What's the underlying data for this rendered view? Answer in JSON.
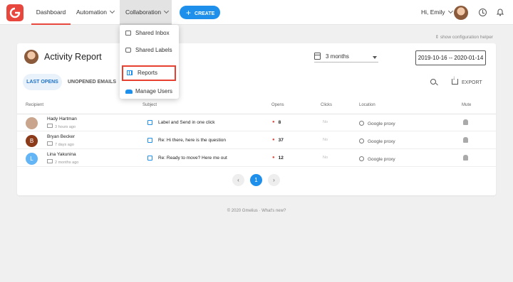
{
  "nav": {
    "dashboard": "Dashboard",
    "automation": "Automation",
    "collaboration": "Collaboration",
    "create": "CREATE",
    "greeting": "Hi, Emily"
  },
  "collab_menu": {
    "items": [
      {
        "label": "Shared Inbox",
        "icon": "inbox-icon"
      },
      {
        "label": "Shared Labels",
        "icon": "label-icon"
      },
      {
        "label": "Reports",
        "icon": "bar-chart-icon"
      },
      {
        "label": "Manage Users",
        "icon": "users-icon"
      }
    ]
  },
  "config_helper": "show configuration helper",
  "report": {
    "title": "Activity Report",
    "range_select": "3 months",
    "date_range": "2019-10-16 -- 2020-01-14",
    "tabs": {
      "opens": "LAST OPENS",
      "unopened": "UNOPENED EMAILS"
    },
    "export": "EXPORT",
    "columns": {
      "recipient": "Recipient",
      "subject": "Subject",
      "opens": "Opens",
      "clicks": "Clicks",
      "location": "Location",
      "mute": "Mute"
    },
    "rows": [
      {
        "initial": "",
        "name": "Hady Hartman",
        "time": "3 hours ago",
        "subject": "Label and Send in one click",
        "opens": "8",
        "clicks": "No",
        "location": "Google proxy",
        "color": "#c8a58c"
      },
      {
        "initial": "B",
        "name": "Bryan Becker",
        "time": "7 days ago",
        "subject": "Re: Hi there, here is the question",
        "opens": "37",
        "clicks": "No",
        "location": "Google proxy",
        "color": "#8b3a1a"
      },
      {
        "initial": "L",
        "name": "Lina Yakunina",
        "time": "2 months ago",
        "subject": "Re: Ready to move? Here me out",
        "opens": "12",
        "clicks": "No",
        "location": "Google proxy",
        "color": "#64b5f6"
      }
    ],
    "pager": {
      "prev": "‹",
      "current": "1",
      "next": "›"
    }
  },
  "footer": "© 2020 Gmelius · What's new?",
  "colors": {
    "brand": "#e8473e",
    "accent": "#1e90ec"
  }
}
